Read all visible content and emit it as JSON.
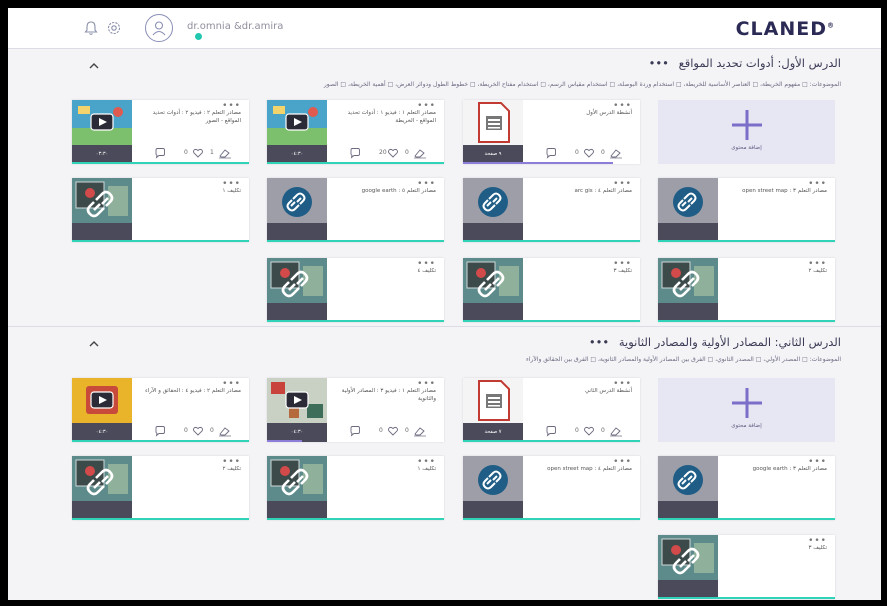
{
  "header": {
    "user_name": "dr.omnia &dr.amira",
    "logo_text": "CLANED",
    "logo_mark": "®",
    "bell_icon": "bell-icon",
    "settings_icon": "gear-icon",
    "accent": "#22c7b0"
  },
  "lessons": [
    {
      "title": "الدرس الأول: أدوات تحديد المواقع",
      "menu": "•••",
      "topics": "الموضوعات: □ مفهوم الخريطة، □ العناصر الأساسية للخريطة، □ استخدام وردة البوصلة، □ استخدام مقياس الرسم، □ استخدام مفتاح الخريطة، □ خطوط الطول ودوائر العرض، □ أهمية الخريطة، □ الصور"
    },
    {
      "title": "الدرس الثاني: المصادر الأولية والمصادر الثانوية",
      "menu": "•••",
      "topics": "الموضوعات: □ المصدر الأولي، □ المصدر الثانوي، □ الفرق بين المصادر الأولية والمصادر الثانوية، □ الفرق بين الحقائق والآراء"
    }
  ],
  "add_label": "إضافة محتوى",
  "cards": {
    "l1_video2": {
      "title": "مصادر التعلم ٢ : فيديو ٢ : أدوات تحديد المواقع - الصور",
      "bar": "٠٣:٣٠",
      "comments": "",
      "likes": "0",
      "views": "1"
    },
    "l1_video1": {
      "title": "مصادر التعلم ١ : فيديو ١ : أدوات تحديد المواقع - الخريطة",
      "bar": "٠٤:٣٠",
      "comments": "",
      "likes": "20",
      "views": "0"
    },
    "l1_pdf": {
      "title": "أنشطة الدرس الأول",
      "bar": "٩ صفحة",
      "comments": "",
      "likes": "0",
      "views": "0"
    },
    "l1_link_google": {
      "title": "مصادر التعلم ٥ : google earth",
      "bar": ""
    },
    "l1_link_arcgis": {
      "title": "مصادر التعلم ٤ : arc gis",
      "bar": ""
    },
    "l1_link_osm": {
      "title": "مصادر التعلم ٣ : open street map",
      "bar": ""
    },
    "l1_task1": {
      "title": "تكليف ١",
      "bar": ""
    },
    "l1_task4": {
      "title": "تكليف ٤",
      "bar": ""
    },
    "l1_task3": {
      "title": "تكليف ٣",
      "bar": ""
    },
    "l1_task2": {
      "title": "تكليف ٢",
      "bar": ""
    },
    "l2_video4": {
      "title": "مصادر التعلم ٢ : فيديو ٤ : الحقائق و الآراء",
      "bar": "٠٤:٣٠",
      "comments": "",
      "likes": "0",
      "views": "0"
    },
    "l2_video3": {
      "title": "مصادر التعلم ١ : فيديو ٣ : المصادر الأولية والثانوية",
      "bar": "٠٤:٣٠",
      "comments": "",
      "likes": "0",
      "views": "0"
    },
    "l2_pdf": {
      "title": "أنشطة الدرس الثاني",
      "bar": "٧ صفحة",
      "comments": "",
      "likes": "0",
      "views": "0"
    },
    "l2_link_osm": {
      "title": "مصادر التعلم ٤ : open street map",
      "bar": ""
    },
    "l2_link_google": {
      "title": "مصادر التعلم ٣ : google earth",
      "bar": ""
    },
    "l2_task2": {
      "title": "تكليف ٢",
      "bar": ""
    },
    "l2_task1": {
      "title": "تكليف ١",
      "bar": ""
    },
    "l2_task3": {
      "title": "تكليف ٣",
      "bar": ""
    }
  }
}
